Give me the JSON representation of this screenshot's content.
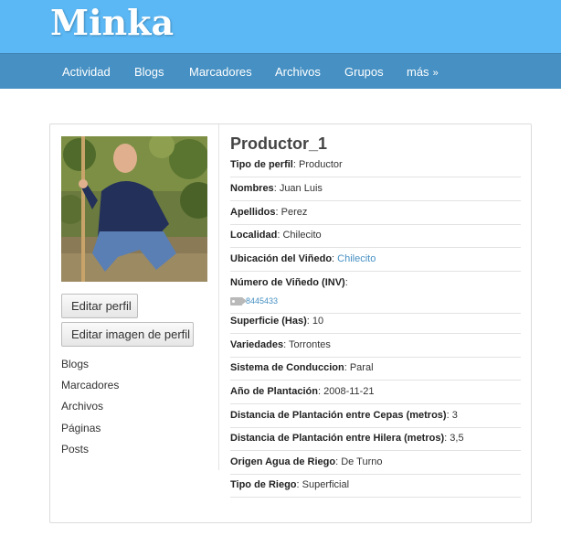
{
  "site": {
    "title": "Minka"
  },
  "nav": {
    "items": [
      {
        "label": "Actividad"
      },
      {
        "label": "Blogs"
      },
      {
        "label": "Marcadores"
      },
      {
        "label": "Archivos"
      },
      {
        "label": "Grupos"
      },
      {
        "label": "más",
        "chevron": "»"
      }
    ]
  },
  "sidebar": {
    "buttons": {
      "edit_profile": "Editar perfil",
      "edit_image": "Editar imagen de perfil"
    },
    "links": [
      "Blogs",
      "Marcadores",
      "Archivos",
      "Páginas",
      "Posts"
    ]
  },
  "profile": {
    "name": "Productor_1",
    "fields": [
      {
        "label": "Tipo de perfil",
        "value": "Productor"
      },
      {
        "label": "Nombres",
        "value": "Juan Luis"
      },
      {
        "label": "Apellidos",
        "value": "Perez"
      },
      {
        "label": "Localidad",
        "value": "Chilecito"
      },
      {
        "label": "Ubicación del Viñedo",
        "value": "Chilecito"
      },
      {
        "label": "Número de Viñedo (INV)",
        "value": "",
        "tag": "8445433"
      },
      {
        "label": "Superficie (Has)",
        "value": "10"
      },
      {
        "label": "Variedades",
        "value": "Torrontes"
      },
      {
        "label": "Sistema de Conduccion",
        "value": "Paral"
      },
      {
        "label": "Año de Plantación",
        "value": "2008-11-21"
      },
      {
        "label": "Distancia de Plantación entre Cepas (metros)",
        "value": "3"
      },
      {
        "label": "Distancia de Plantación entre Hilera (metros)",
        "value": "3,5"
      },
      {
        "label": "Origen Agua de Riego",
        "value": "De Turno"
      },
      {
        "label": "Tipo de Riego",
        "value": "Superficial"
      }
    ]
  },
  "colors": {
    "header": "#5bb8f5",
    "navbar": "#4690c3",
    "link": "#4690c3"
  },
  "icons": {
    "tag": "tag-icon"
  }
}
